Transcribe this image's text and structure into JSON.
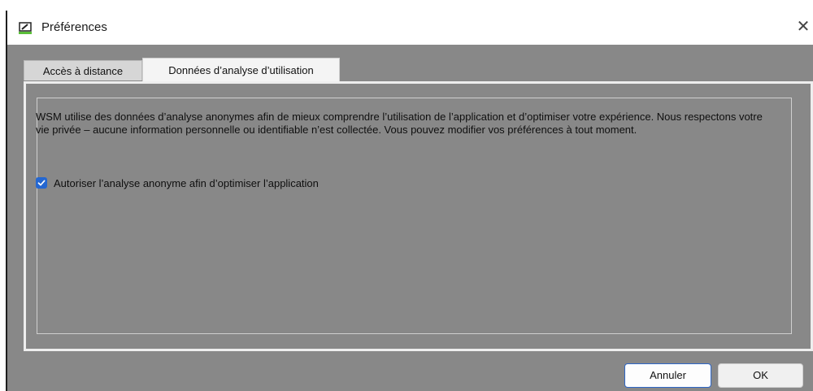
{
  "window": {
    "title": "Préférences",
    "close_glyph": "✕",
    "icon": "preferences-app-icon"
  },
  "tabs": [
    {
      "label": "Accès à distance",
      "active": false
    },
    {
      "label": "Données d’analyse d’utilisation",
      "active": true
    }
  ],
  "panel": {
    "description": "WSM utilise des données d’analyse anonymes afin de mieux comprendre l’utilisation de l’application et d’optimiser votre expérience. Nous respectons votre vie privée – aucune information personnelle ou identifiable n’est collectée. Vous pouvez modifier vos préférences à tout moment.",
    "checkbox": {
      "label": "Autoriser l’analyse anonyme afin d’optimiser l’application",
      "checked": true
    }
  },
  "buttons": {
    "cancel_label": "Annuler",
    "ok_label": "OK"
  },
  "colors": {
    "body_gray": "#888888",
    "accent_blue": "#2467d1"
  }
}
